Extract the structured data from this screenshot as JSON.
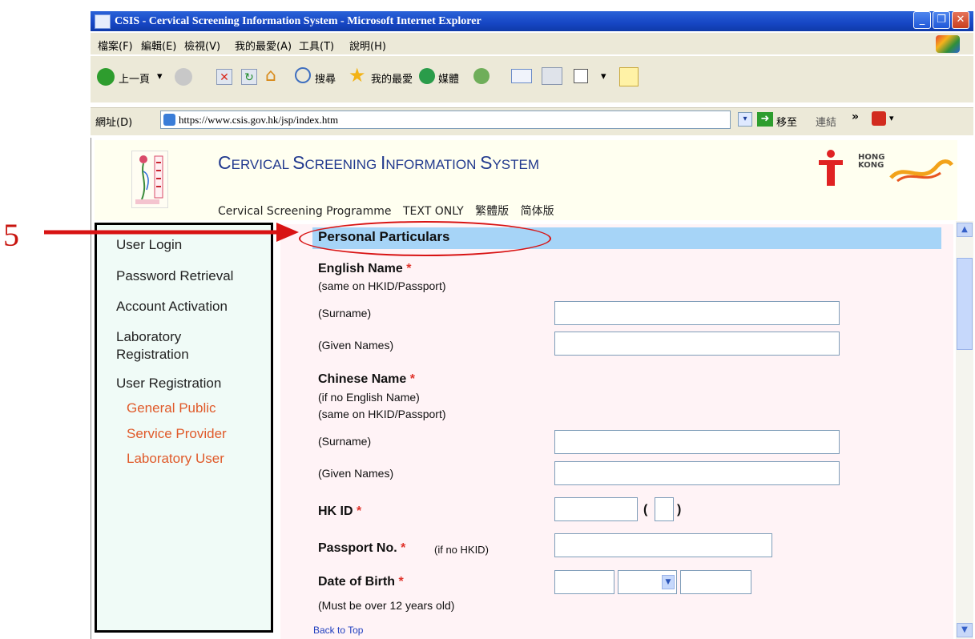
{
  "window": {
    "title": "CSIS - Cervical Screening Information System - Microsoft Internet Explorer",
    "controls": [
      "_",
      "❐",
      "✕"
    ]
  },
  "menubar": [
    "檔案(F)",
    "編輯(E)",
    "檢視(V)",
    "我的最愛(A)",
    "工具(T)",
    "說明(H)"
  ],
  "toolbar": {
    "back": "上一頁",
    "search": "搜尋",
    "favorites": "我的最愛",
    "media": "媒體"
  },
  "address": {
    "label": "網址(D)",
    "url": "https://www.csis.gov.hk/jsp/index.htm",
    "go": "移至",
    "links": "連結"
  },
  "header": {
    "title_C": "C",
    "title_ervical": "ERVICAL ",
    "title_S": "S",
    "title_creening": "CREENING ",
    "title_I": "I",
    "title_nformation": "NFORMATION ",
    "title_S2": "S",
    "title_ystem": "YSTEM",
    "links": [
      "Cervical Screening Programme",
      "TEXT ONLY",
      "繁體版",
      "简体版"
    ],
    "hk_line1": "HONG",
    "hk_line2": "KONG"
  },
  "sidebar": {
    "items": [
      "User Login",
      "Password Retrieval",
      "Account Activation",
      "Laboratory",
      "Registration",
      "User Registration"
    ],
    "subitems": [
      "General Public",
      "Service Provider",
      "Laboratory User"
    ]
  },
  "form": {
    "section_title": "Personal Particulars",
    "english_name": "English Name",
    "english_note": "(same on HKID/Passport)",
    "surname": "(Surname)",
    "given_names": "(Given Names)",
    "chinese_name": "Chinese Name",
    "chinese_note1": "(if no English Name)",
    "chinese_note2": "(same on HKID/Passport)",
    "hkid": "HK ID",
    "paren_open": "(",
    "paren_close": ")",
    "passport": "Passport No.",
    "passport_note": "(if no HKID)",
    "dob": "Date of Birth",
    "dob_note": "(Must be over 12 years old)",
    "back_to_top": "Back to Top",
    "required_mark": "*"
  },
  "annotation": {
    "number": "5"
  },
  "colors": {
    "title_bar": "#1646c4",
    "section_bar": "#a6d4f7",
    "form_bg": "#fff3f6",
    "sidebar_bg": "#f0fbf7",
    "sub_link": "#e05a2a",
    "annotation": "#d81313"
  }
}
